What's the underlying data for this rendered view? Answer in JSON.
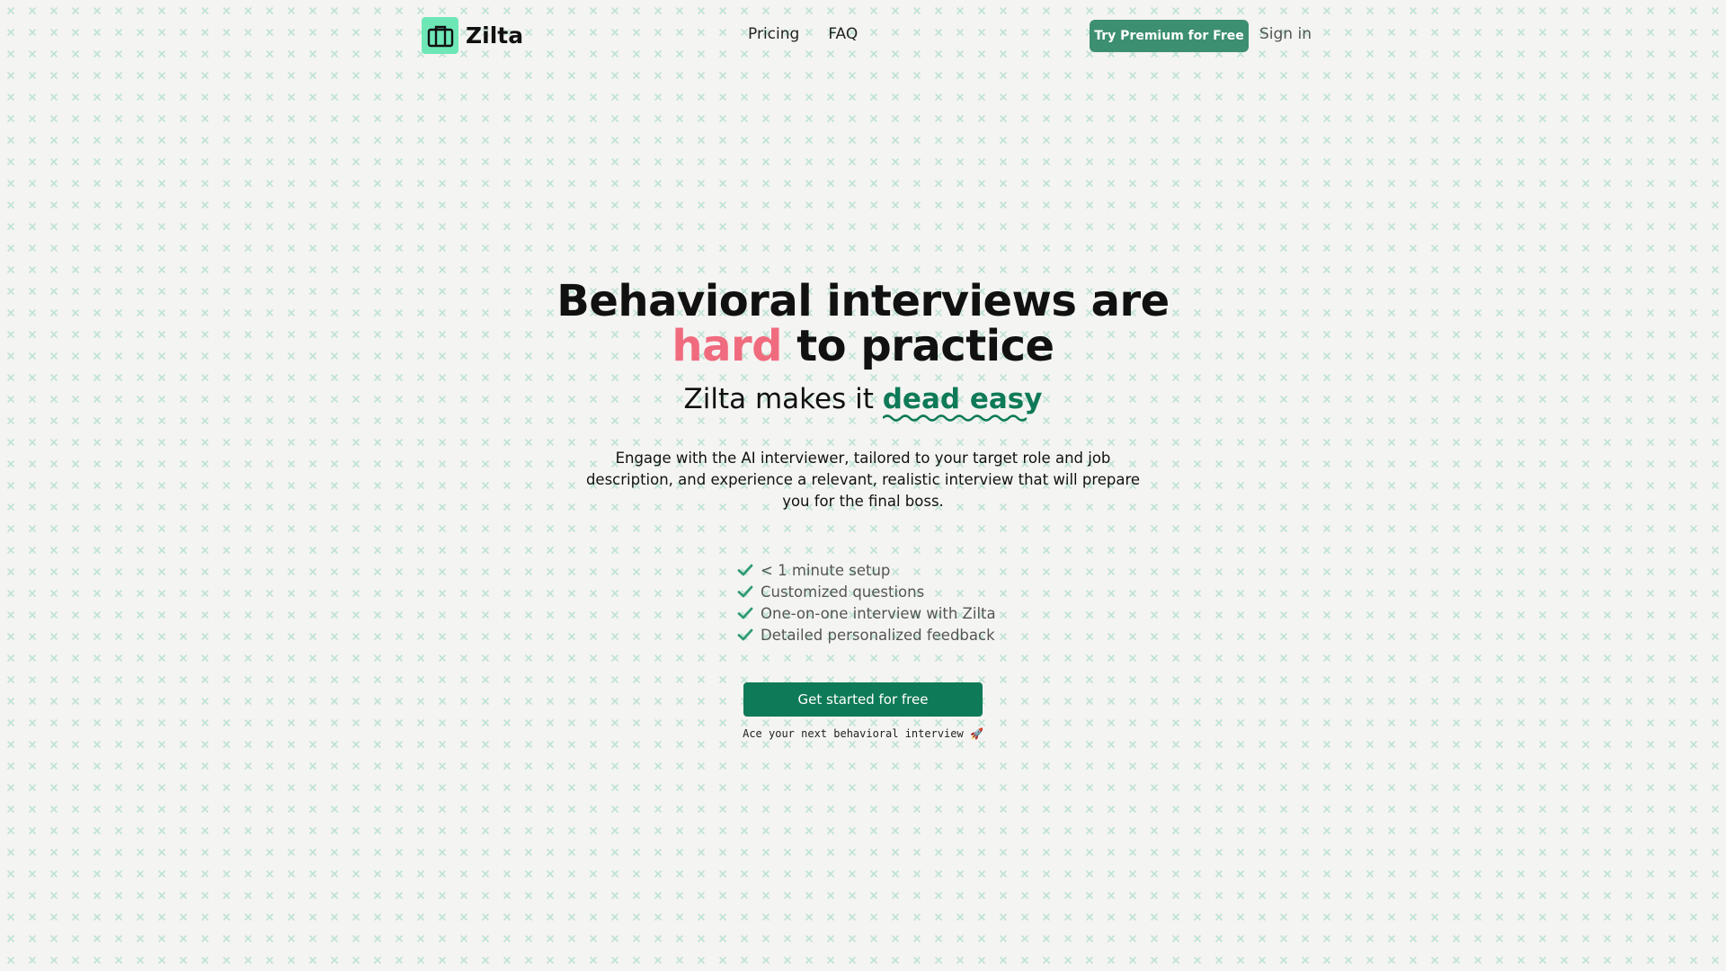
{
  "brand": {
    "name": "Zilta",
    "accent": "#6ee7b7",
    "primary": "#0f7a57",
    "highlight": "#f06b7e"
  },
  "nav": {
    "items": [
      "Pricing",
      "FAQ"
    ]
  },
  "header": {
    "premium_label": "Try Premium for Free",
    "signin_label": "Sign in"
  },
  "hero": {
    "title_line1": "Behavioral interviews are",
    "title_hard": "hard",
    "title_rest": " to practice",
    "sub_prefix": "Zilta makes it ",
    "sub_emph": "dead easy",
    "description": "Engage with the AI interviewer, tailored to your target role and job description, and experience a relevant, realistic interview that will prepare you for the final boss."
  },
  "features": [
    "< 1 minute setup",
    "Customized questions",
    "One-on-one interview with Zilta",
    "Detailed personalized feedback"
  ],
  "cta": {
    "label": "Get started for free",
    "tagline": "Ace your next behavioral interview 🚀"
  },
  "icons": {
    "logo": "briefcase-icon",
    "feature": "check-icon"
  }
}
